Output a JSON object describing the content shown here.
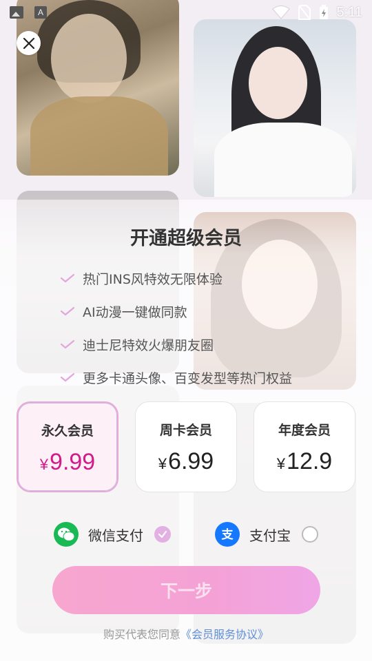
{
  "status_bar": {
    "time": "5:11",
    "left_icons": [
      "image-icon",
      "accessibility-a-icon"
    ],
    "right_icons": [
      "wifi-icon",
      "no-sim-icon",
      "battery-charging-icon"
    ],
    "a_glyph": "A"
  },
  "close_label": "✕",
  "title": "开通超级会员",
  "features": [
    "热门INS风特效无限体验",
    "AI动漫一键做同款",
    "迪士尼特效火爆朋友圈",
    "更多卡通头像、百变发型等热门权益"
  ],
  "plans": [
    {
      "name": "永久会员",
      "currency": "¥",
      "price": "9.99",
      "selected": true
    },
    {
      "name": "周卡会员",
      "currency": "¥",
      "price": "6.99",
      "selected": false
    },
    {
      "name": "年度会员",
      "currency": "¥",
      "price": "12.9",
      "selected": false
    }
  ],
  "payment": {
    "wechat": {
      "label": "微信支付",
      "selected": true
    },
    "alipay": {
      "label": "支付宝",
      "selected": false
    }
  },
  "next_button": "下一步",
  "agreement": {
    "prefix": "购买代表您同意",
    "link": "《会员服务协议》"
  },
  "colors": {
    "accent_pink": "#d21a8a",
    "check_pink": "#e3a6dc",
    "wechat_green": "#19b955",
    "alipay_blue": "#1678ff",
    "link_blue": "#5f8fd8"
  }
}
